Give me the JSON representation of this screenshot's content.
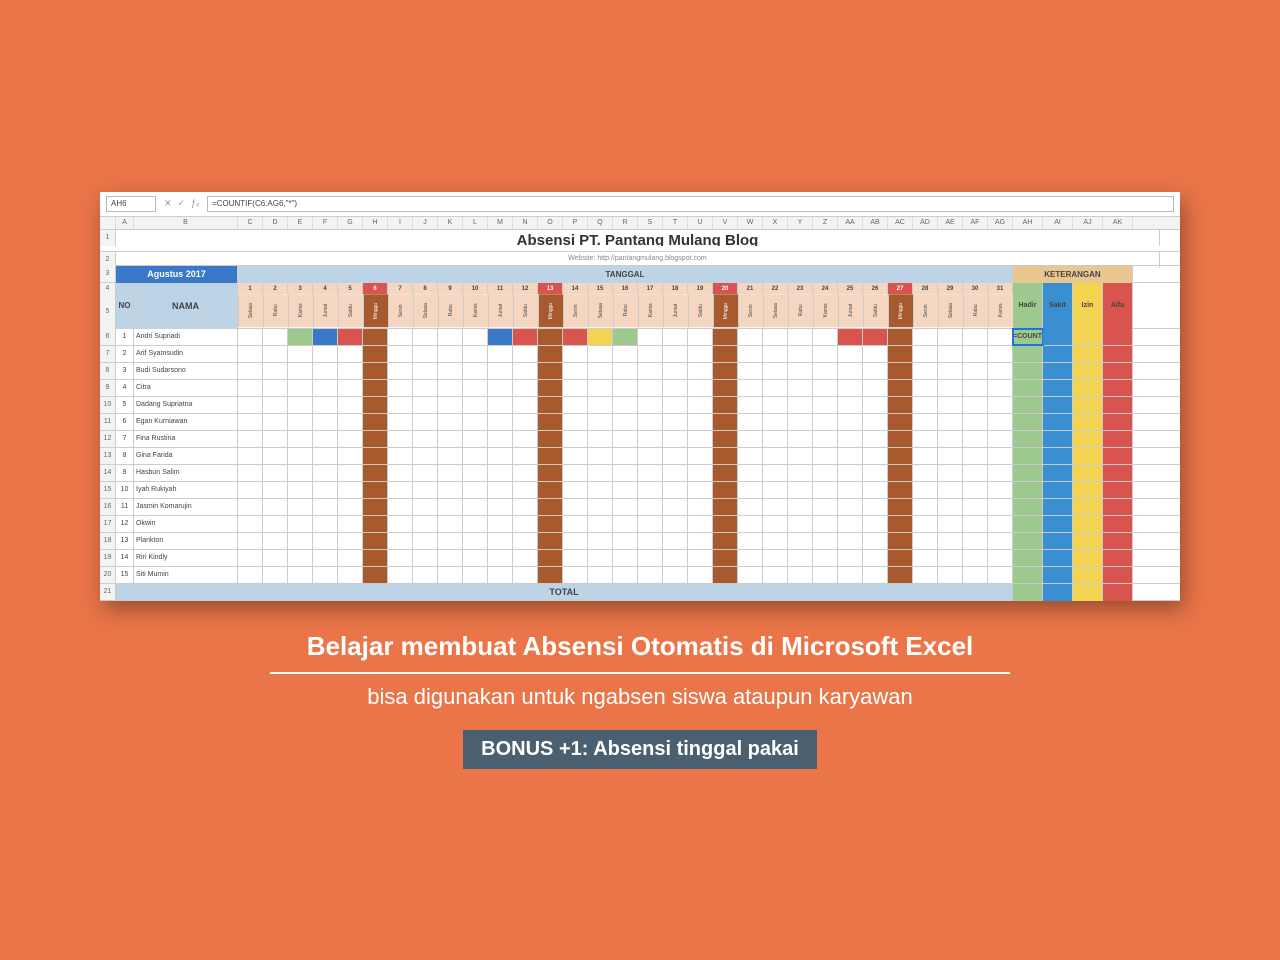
{
  "formula_bar": {
    "cell_name": "AH6",
    "fx": "ƒₓ",
    "formula": "=COUNTIF(C6:AG6,\"*\")"
  },
  "col_letters": [
    "A",
    "B",
    "C",
    "D",
    "E",
    "F",
    "G",
    "H",
    "I",
    "J",
    "K",
    "L",
    "M",
    "N",
    "O",
    "P",
    "Q",
    "R",
    "S",
    "T",
    "U",
    "V",
    "W",
    "X",
    "Y",
    "Z",
    "AA",
    "AB",
    "AC",
    "AD",
    "AE",
    "AF",
    "AG",
    "AH",
    "AI",
    "AJ",
    "AK"
  ],
  "sheet": {
    "title": "Absensi PT. Pantang Mulang Blog",
    "website": "Website: http://pantangmulang.blogspot.com",
    "month": "Agustus 2017",
    "tanggal_label": "TANGGAL",
    "keterangan_label": "KETERANGAN",
    "no_label": "NO",
    "nama_label": "NAMA",
    "total_label": "TOTAL",
    "dates": [
      1,
      2,
      3,
      4,
      5,
      6,
      7,
      8,
      9,
      10,
      11,
      12,
      13,
      14,
      15,
      16,
      17,
      18,
      19,
      20,
      21,
      22,
      23,
      24,
      25,
      26,
      27,
      28,
      29,
      30,
      31
    ],
    "dows": [
      "Selasa",
      "Rabu",
      "Kamis",
      "Jumat",
      "Sabtu",
      "Minggu",
      "Senin",
      "Selasa",
      "Rabu",
      "Kamis",
      "Jumat",
      "Sabtu",
      "Minggu",
      "Senin",
      "Selasa",
      "Rabu",
      "Kamis",
      "Jumat",
      "Sabtu",
      "Minggu",
      "Senin",
      "Selasa",
      "Rabu",
      "Kamis",
      "Jumat",
      "Sabtu",
      "Minggu",
      "Senin",
      "Selasa",
      "Rabu",
      "Kamis"
    ],
    "sundays": [
      6,
      13,
      20,
      27
    ],
    "ket": [
      "Hadir",
      "Sakit",
      "Izin",
      "Alfa"
    ],
    "first_row_formula": "=COUNTIF"
  },
  "names": [
    "Andri Supriadi",
    "Arif Syamsudin",
    "Budi Sudarsono",
    "Citra",
    "Dadang Supriatna",
    "Egan Kurniawan",
    "Fina Rustina",
    "Gina Farida",
    "Hasbun Salim",
    "Iyah Rukiyah",
    "Jasmin Komarujin",
    "Okwin",
    "Plankton",
    "Riri Kindly",
    "Siti Mumin"
  ],
  "row1_marks": {
    "1": "",
    "2": "",
    "3": "g",
    "4": "b",
    "5": "r",
    "7": "",
    "8": "",
    "9": "",
    "10": "",
    "11": "b",
    "12": "r",
    "14": "r",
    "15": "y",
    "16": "g",
    "17": "",
    "25": "r",
    "26": "r"
  },
  "caption": {
    "line1": "Belajar membuat Absensi Otomatis di Microsoft Excel",
    "line2": "bisa digunakan untuk ngabsen siswa ataupun karyawan",
    "bonus": "BONUS +1: Absensi tinggal pakai"
  },
  "colors": {
    "accent": "#e97548",
    "sunday": "#a65a2e",
    "header_blue": "#3a78c9",
    "ket": [
      "#9ec98e",
      "#3a8fd0",
      "#f2d452",
      "#d9534f"
    ]
  }
}
